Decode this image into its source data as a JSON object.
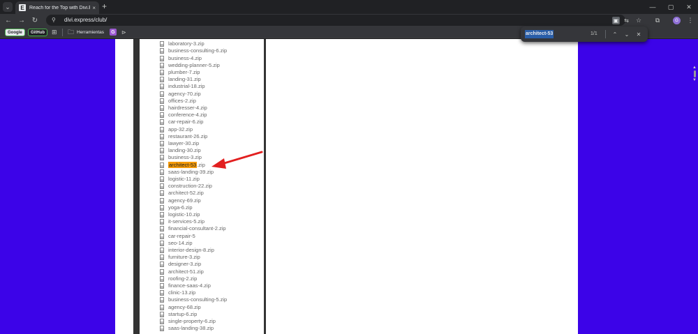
{
  "tab": {
    "title": "Reach for the Top with Divi.Express",
    "favicon_letter": "E",
    "close": "×"
  },
  "tabstrip": {
    "list_icon": "⌄",
    "new_tab_icon": "+",
    "minimize": "—",
    "maximize": "▢",
    "close": "✕"
  },
  "toolbar": {
    "back_icon": "←",
    "forward_icon": "→",
    "reload_icon": "↻",
    "site_info_icon": "⚲",
    "url": "divi.express/club/",
    "profile_letter": "G"
  },
  "bookmarks": {
    "google": "Google",
    "github": "GitHub",
    "apps_icon": "⊞",
    "folder_icon": "🗀",
    "folder_label": "Herramientas",
    "g_letter": "G",
    "arrow": "⊳"
  },
  "find_bar": {
    "query": "architect-53",
    "count": "1/1",
    "prev_icon": "⌃",
    "next_icon": "⌄",
    "close_icon": "✕"
  },
  "files": [
    "laboratory-3.zip",
    "business-consulting-6.zip",
    "business-4.zip",
    "wedding-planner-5.zip",
    "plumber-7.zip",
    "landing-31.zip",
    "industrial-18.zip",
    "agency-70.zip",
    "offices-2.zip",
    "hairdresser-4.zip",
    "conference-4.zip",
    "car-repair-6.zip",
    "app-32.zip",
    "restaurant-26.zip",
    "lawyer-30.zip",
    "landing-30.zip",
    "business-3.zip",
    "architect-53.zip",
    "saas-landing-39.zip",
    "logistic-11.zip",
    "construction-22.zip",
    "architect-52.zip",
    "agency-69.zip",
    "yoga-6.zip",
    "logistic-10.zip",
    "it-services-5.zip",
    "financial-consultant-2.zip",
    "car-repair-5",
    "seo-14.zip",
    "interior-design-8.zip",
    "furniture-3.zip",
    "designer-3.zip",
    "architect-51.zip",
    "roofing-2.zip",
    "finance-saas-4.zip",
    "clinic-13.zip",
    "business-consulting-5.zip",
    "agency-68.zip",
    "startup-6.zip",
    "single-property-6.zip",
    "saas-landing-38.zip"
  ],
  "highlight": {
    "match_part": "architect-53",
    "rest": ".zip",
    "color": "#f59b0a"
  },
  "colors": {
    "page_background": "#3c03e8",
    "arrow": "#e21f1f"
  }
}
